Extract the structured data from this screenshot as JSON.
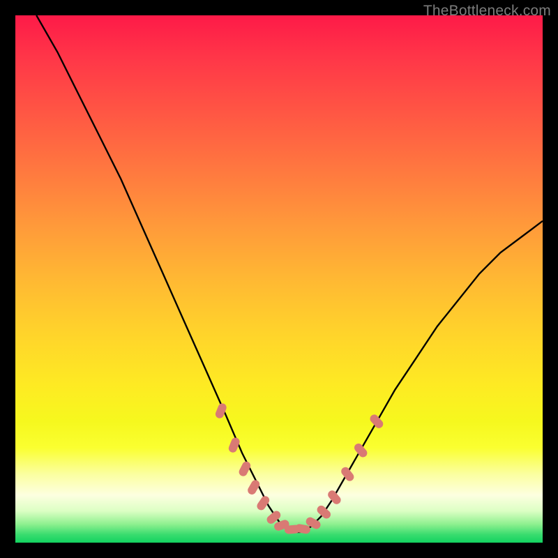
{
  "watermark": "TheBottleneck.com",
  "chart_data": {
    "type": "line",
    "title": "",
    "xlabel": "",
    "ylabel": "",
    "xlim": [
      0,
      100
    ],
    "ylim": [
      0,
      100
    ],
    "grid": false,
    "legend": false,
    "series": [
      {
        "name": "bottleneck-curve",
        "color": "#000000",
        "x": [
          4,
          8,
          12,
          16,
          20,
          24,
          28,
          32,
          36,
          40,
          43,
          46,
          48,
          50,
          52,
          54,
          56,
          58,
          60,
          64,
          68,
          72,
          76,
          80,
          84,
          88,
          92,
          96,
          100
        ],
        "y": [
          100,
          93,
          85,
          77,
          69,
          60,
          51,
          42,
          33,
          24,
          17,
          11,
          7,
          4,
          2,
          2,
          3,
          5,
          8,
          15,
          22,
          29,
          35,
          41,
          46,
          51,
          55,
          58,
          61
        ]
      }
    ],
    "markers": {
      "name": "highlights",
      "shape": "rounded-rect",
      "color": "#d97a74",
      "points": [
        {
          "x": 39.0,
          "y": 25.0,
          "angle": -68
        },
        {
          "x": 41.5,
          "y": 18.5,
          "angle": -68
        },
        {
          "x": 43.5,
          "y": 14.0,
          "angle": -63
        },
        {
          "x": 45.2,
          "y": 10.5,
          "angle": -60
        },
        {
          "x": 47.0,
          "y": 7.5,
          "angle": -55
        },
        {
          "x": 49.0,
          "y": 4.8,
          "angle": -40
        },
        {
          "x": 50.5,
          "y": 3.3,
          "angle": -20
        },
        {
          "x": 52.5,
          "y": 2.5,
          "angle": -5
        },
        {
          "x": 54.5,
          "y": 2.6,
          "angle": 10
        },
        {
          "x": 56.5,
          "y": 3.7,
          "angle": 28
        },
        {
          "x": 58.5,
          "y": 5.8,
          "angle": 42
        },
        {
          "x": 60.5,
          "y": 8.6,
          "angle": 50
        },
        {
          "x": 63.0,
          "y": 13.0,
          "angle": 52
        },
        {
          "x": 65.5,
          "y": 17.5,
          "angle": 50
        },
        {
          "x": 68.5,
          "y": 23.0,
          "angle": 48
        }
      ]
    }
  }
}
